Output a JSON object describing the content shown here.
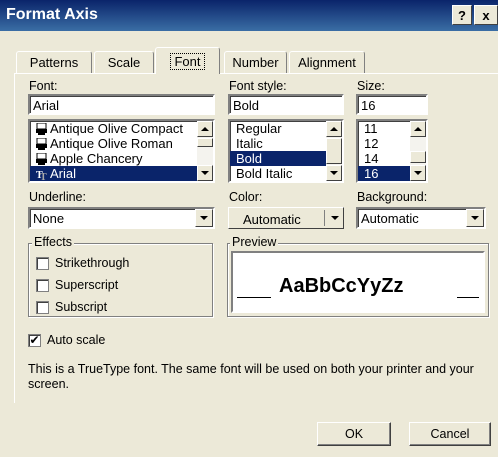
{
  "window": {
    "title": "Format Axis",
    "help_label": "?",
    "close_label": "x"
  },
  "tabs": [
    {
      "label": "Patterns"
    },
    {
      "label": "Scale"
    },
    {
      "label": "Font",
      "active": true
    },
    {
      "label": "Number"
    },
    {
      "label": "Alignment"
    }
  ],
  "font": {
    "label": "Font:",
    "value": "Arial",
    "items": [
      "Antique Olive Compact",
      "Antique Olive Roman",
      "Apple Chancery",
      "Arial"
    ],
    "selected": "Arial"
  },
  "font_style": {
    "label": "Font style:",
    "value": "Bold",
    "items": [
      "Regular",
      "Italic",
      "Bold",
      "Bold Italic"
    ],
    "selected": "Bold"
  },
  "size": {
    "label": "Size:",
    "value": "16",
    "items": [
      "11",
      "12",
      "14",
      "16"
    ],
    "selected": "16"
  },
  "underline": {
    "label": "Underline:",
    "value": "None"
  },
  "color": {
    "label": "Color:",
    "value": "Automatic"
  },
  "background": {
    "label": "Background:",
    "value": "Automatic"
  },
  "effects": {
    "title": "Effects",
    "strikethrough": "Strikethrough",
    "superscript": "Superscript",
    "subscript": "Subscript"
  },
  "preview": {
    "title": "Preview",
    "sample": "AaBbCcYyZz"
  },
  "auto_scale": {
    "label": "Auto scale",
    "checked": true
  },
  "info_text": "This is a TrueType font.  The same font will be used on both your printer and your screen.",
  "buttons": {
    "ok": "OK",
    "cancel": "Cancel"
  },
  "colors": {
    "titlebar": "#0a246a",
    "dialog_bg": "#ece9d8",
    "selection": "#0a246a"
  }
}
